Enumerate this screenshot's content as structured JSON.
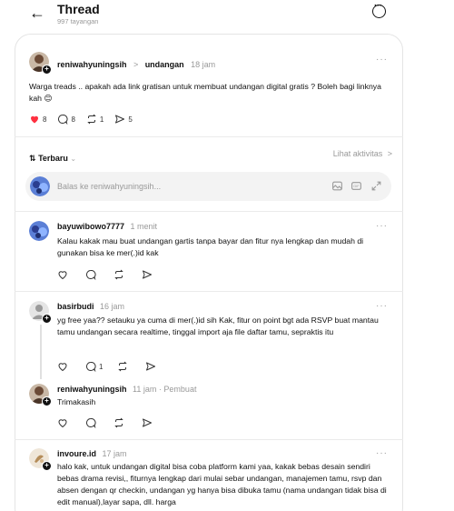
{
  "header": {
    "title": "Thread",
    "views": "997 tayangan"
  },
  "post": {
    "username": "reniwahyuningsih",
    "separator": ">",
    "topic": "undangan",
    "time": "18 jam",
    "text": "Warga treads .. apakah ada link gratisan untuk membuat undangan digital gratis ? Boleh bagi linknya kah 😊",
    "likes": "8",
    "comments": "8",
    "reposts": "1",
    "shares": "5",
    "like_color": "#ff3040"
  },
  "sort": {
    "label": "Terbaru",
    "icon": "⇅",
    "activity": "Lihat aktivitas",
    "activity_chevron": ">"
  },
  "reply_box": {
    "placeholder": "Balas ke reniwahyuningsih..."
  },
  "replies": [
    {
      "username": "bayuwibowo7777",
      "time": "1 menit",
      "text": "Kalau kakak mau buat undangan gartis tanpa bayar dan fitur nya lengkap dan mudah di gunakan bisa ke mer(.)id kak",
      "comments": ""
    },
    {
      "username": "basirbudi",
      "time": "16 jam",
      "text": "yg free yaa?? setauku ya cuma di mer(.)id sih Kak, fitur on point bgt ada RSVP buat mantau tamu undangan secara realtime, tinggal import aja file daftar tamu, sepraktis itu",
      "comments": "1"
    },
    {
      "username": "reniwahyuningsih",
      "time": "11 jam",
      "tag": "Pembuat",
      "text": "Trimakasih",
      "comments": ""
    },
    {
      "username": "invoure.id",
      "time": "17 jam",
      "text": "halo kak, untuk undangan digital bisa coba platform kami yaa, kakak bebas desain sendiri bebas drama revisi,, fiturnya lengkap dari mulai sebar undangan, manajemen tamu, rsvp dan absen dengan qr checkin, undangan yg hanya bisa dibuka tamu (nama undangan tidak bisa di edit manual),layar sapa, dll. harga"
    }
  ]
}
